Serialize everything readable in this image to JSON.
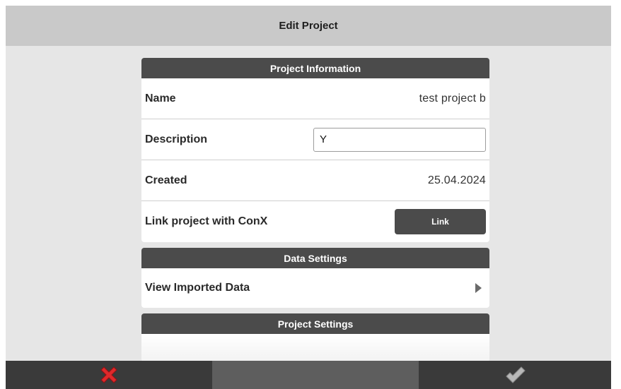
{
  "header": {
    "title": "Edit Project"
  },
  "project_information": {
    "title": "Project Information",
    "name_label": "Name",
    "name_value": "test project b",
    "description_label": "Description",
    "description_value": "Y",
    "created_label": "Created",
    "created_value": "25.04.2024",
    "link_label": "Link project with ConX",
    "link_button": "Link"
  },
  "data_settings": {
    "title": "Data Settings",
    "view_imported_label": "View Imported Data"
  },
  "project_settings": {
    "title": "Project Settings"
  },
  "footer": {
    "cancel_icon": "close-x-icon",
    "confirm_icon": "checkmark-icon",
    "cancel_color": "#e0292b",
    "confirm_color": "#b8b8b8"
  }
}
